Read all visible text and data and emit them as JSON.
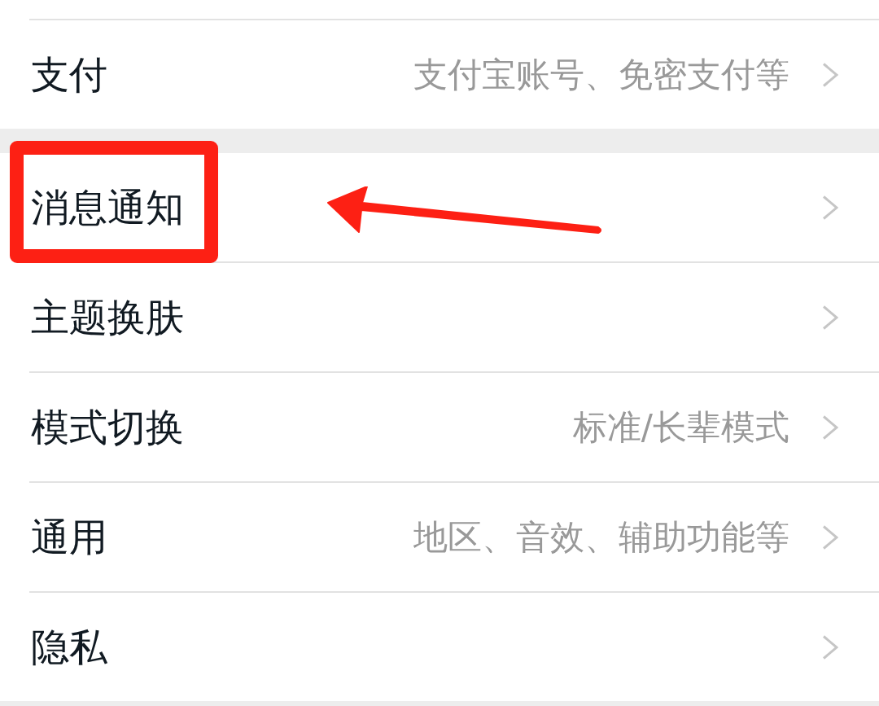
{
  "groups": [
    {
      "rows": [
        {
          "label": "支付",
          "value": "支付宝账号、免密支付等",
          "highlighted": false
        }
      ]
    },
    {
      "rows": [
        {
          "label": "消息通知",
          "highlighted": true
        },
        {
          "label": "主题换肤",
          "highlighted": false
        },
        {
          "label": "模式切换",
          "value": "标准/长辈模式",
          "highlighted": false
        },
        {
          "label": "通用",
          "value": "地区、音效、辅助功能等",
          "highlighted": false
        },
        {
          "label": "隐私",
          "highlighted": false
        }
      ]
    }
  ]
}
